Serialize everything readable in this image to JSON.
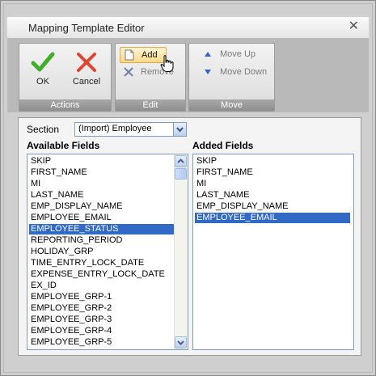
{
  "window": {
    "title": "Mapping Template Editor",
    "close_glyph": "✕"
  },
  "toolbar": {
    "groups": {
      "actions": "Actions",
      "edit": "Edit",
      "move": "Move"
    },
    "ok_label": "OK",
    "cancel_label": "Cancel",
    "add_label": "Add",
    "remove_label": "Remove",
    "move_up_label": "Move Up",
    "move_down_label": "Move Down"
  },
  "section": {
    "label": "Section",
    "value": "(Import) Employee"
  },
  "available": {
    "heading": "Available Fields",
    "selected_index": 6,
    "items": [
      "SKIP",
      "FIRST_NAME",
      "MI",
      "LAST_NAME",
      "EMP_DISPLAY_NAME",
      "EMPLOYEE_EMAIL",
      "EMPLOYEE_STATUS",
      "REPORTING_PERIOD",
      "HOLIDAY_GRP",
      "TIME_ENTRY_LOCK_DATE",
      "EXPENSE_ENTRY_LOCK_DATE",
      "EX_ID",
      "EMPLOYEE_GRP-1",
      "EMPLOYEE_GRP-2",
      "EMPLOYEE_GRP-3",
      "EMPLOYEE_GRP-4",
      "EMPLOYEE_GRP-5"
    ]
  },
  "added": {
    "heading": "Added Fields",
    "selected_index": 5,
    "items": [
      "SKIP",
      "FIRST_NAME",
      "MI",
      "LAST_NAME",
      "EMP_DISPLAY_NAME",
      "EMPLOYEE_EMAIL"
    ]
  },
  "colors": {
    "selection": "#3169c6",
    "ok_green": "#3fae2a",
    "cancel_red": "#e0462f",
    "arrow_blue": "#3a63c9"
  }
}
